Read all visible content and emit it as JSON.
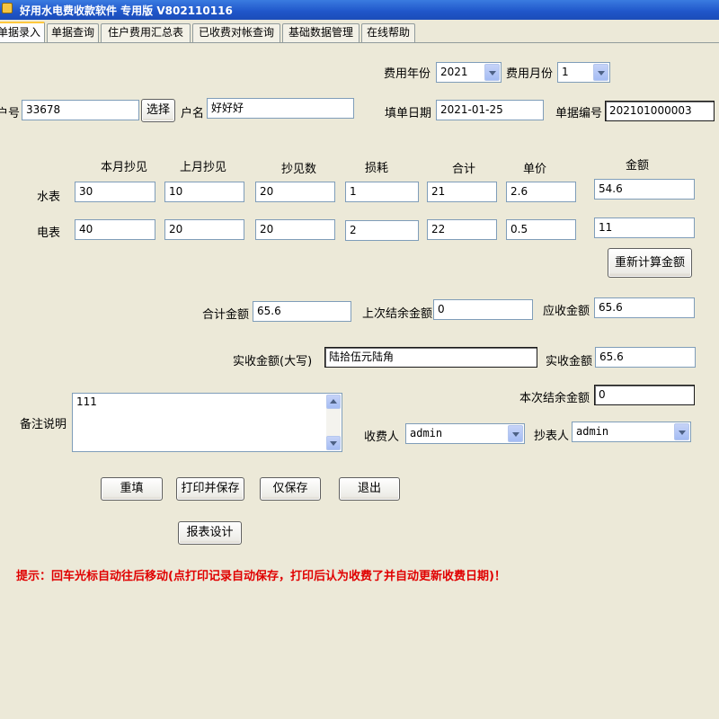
{
  "window": {
    "title": "好用水电费收款软件 专用版 V802110116"
  },
  "tabs": [
    {
      "label": "单据录入",
      "active": true
    },
    {
      "label": "单据查询",
      "active": false
    },
    {
      "label": "住户费用汇总表",
      "active": false
    },
    {
      "label": "已收费对帐查询",
      "active": false
    },
    {
      "label": "基础数据管理",
      "active": false
    },
    {
      "label": "在线帮助",
      "active": false
    }
  ],
  "header": {
    "fee_year_label": "费用年份",
    "fee_year_value": "2021",
    "fee_month_label": "费用月份",
    "fee_month_value": "1",
    "account_no_label": "户号",
    "account_no_value": "33678",
    "select_button": "选择",
    "account_name_label": "户名",
    "account_name_value": "好好好",
    "fill_date_label": "填单日期",
    "fill_date_value": "2021-01-25",
    "doc_no_label": "单据编号",
    "doc_no_value": "202101000003"
  },
  "readings": {
    "columns": [
      "本月抄见",
      "上月抄见",
      "抄见数",
      "损耗",
      "合计",
      "单价",
      "金额"
    ],
    "rows": [
      {
        "label": "水表",
        "values": [
          "30",
          "10",
          "20",
          "1",
          "21",
          "2.6",
          "54.6"
        ]
      },
      {
        "label": "电表",
        "values": [
          "40",
          "20",
          "20",
          "2",
          "22",
          "0.5",
          "11"
        ]
      }
    ],
    "recalc_button": "重新计算金额"
  },
  "totals": {
    "total_label": "合计金额",
    "total_value": "65.6",
    "prev_balance_label": "上次结余金额",
    "prev_balance_value": "0",
    "receivable_label": "应收金额",
    "receivable_value": "65.6",
    "received_caps_label": "实收金额(大写)",
    "received_caps_value": "陆拾伍元陆角",
    "received_label": "实收金额",
    "received_value": "65.6",
    "this_balance_label": "本次结余金额",
    "this_balance_value": "0"
  },
  "notes": {
    "label": "备注说明",
    "value": "111"
  },
  "people": {
    "collector_label": "收费人",
    "collector_value": "admin",
    "reader_label": "抄表人",
    "reader_value": "admin"
  },
  "actions": {
    "reset": "重填",
    "print_save": "打印并保存",
    "save_only": "仅保存",
    "exit": "退出",
    "report_design": "报表设计"
  },
  "hint": "提示：回车光标自动往后移动(点打印记录自动保存，打印后认为收费了并自动更新收费日期)！"
}
